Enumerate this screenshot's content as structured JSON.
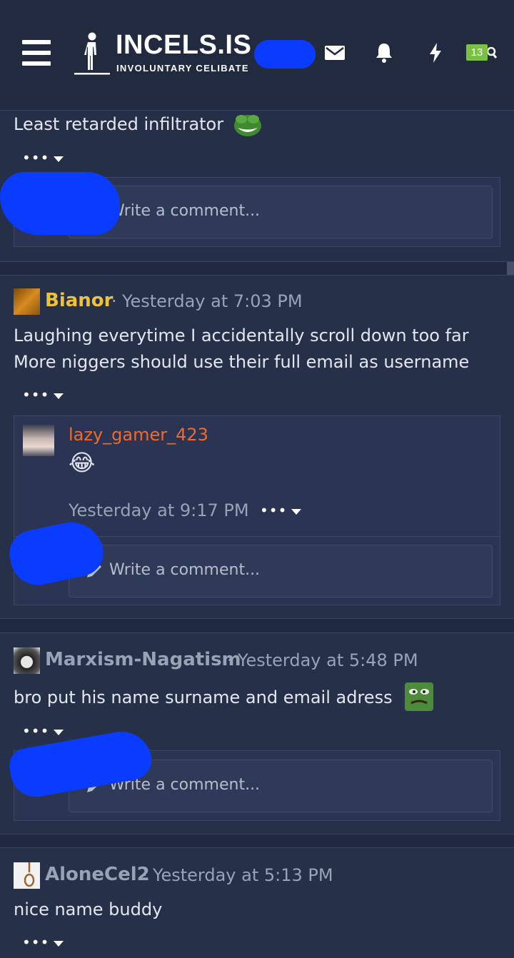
{
  "header": {
    "logo_title": "INCELS.IS",
    "logo_subtitle": "INVOLUNTARY CELIBATE",
    "notification_count": "13",
    "icons": [
      "menu-icon",
      "envelope-icon",
      "bell-icon",
      "lightning-icon",
      "search-icon"
    ],
    "colors": {
      "background": "#222a40",
      "badge": "#7ac143",
      "redaction": "#0a3cff"
    }
  },
  "top_post": {
    "text": "Least retarded infiltrator",
    "menu": "•••",
    "comment_placeholder": "Write a comment..."
  },
  "posts": [
    {
      "username": "Bianor",
      "username_color": "#f0c23a",
      "separator": "·",
      "timestamp": "Yesterday at 7:03 PM",
      "lines": [
        "Laughing everytime I accidentally scroll down too far",
        "More niggers should use their full email as username"
      ],
      "menu": "•••",
      "reply": {
        "username": "lazy_gamer_423",
        "username_color": "#f06a2e",
        "emoji": "😂",
        "timestamp": "Yesterday at 9:17 PM",
        "menu": "•••"
      },
      "comment_placeholder": "Write a comment..."
    },
    {
      "username": "Marxism-Nagatism",
      "username_color": "#9aa2b6",
      "separator": "·",
      "timestamp": "Yesterday at 5:48 PM",
      "text": "bro put his name surname and email adress",
      "menu": "•••",
      "comment_placeholder": "Write a comment..."
    },
    {
      "username": "AloneCel2",
      "username_color": "#9aa2b6",
      "separator": "·",
      "timestamp": "Yesterday at 5:13 PM",
      "text": "nice name buddy",
      "menu": "•••"
    }
  ]
}
